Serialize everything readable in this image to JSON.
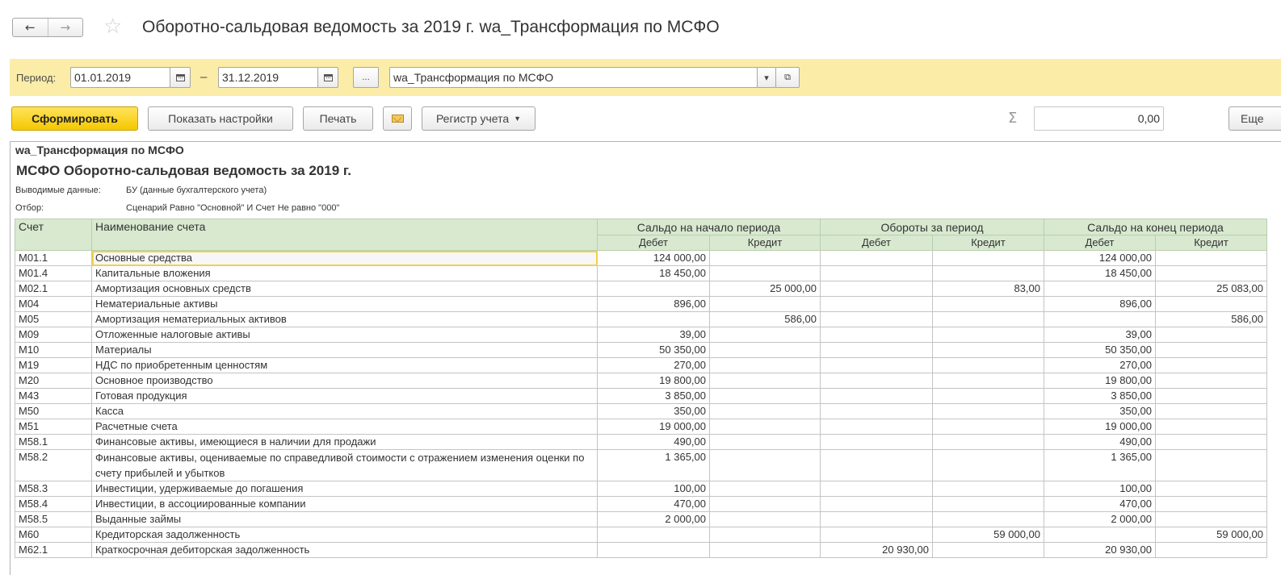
{
  "window": {
    "title": "Оборотно-сальдовая ведомость за 2019 г. wa_Трансформация по МСФО",
    "back_icon": "←",
    "forward_icon": "→",
    "favorite_icon": "☆"
  },
  "period_panel": {
    "label": "Период:",
    "date_from": "01.01.2019",
    "dash": "–",
    "date_to": "31.12.2019",
    "ellipsis": "...",
    "organization": "wa_Трансформация по МСФО",
    "dropdown_icon": "▾",
    "open_icon": "⧉"
  },
  "toolbar": {
    "generate": "Сформировать",
    "show_settings": "Показать настройки",
    "print": "Печать",
    "register": "Регистр учета",
    "sigma": "Σ",
    "sum_value": "0,00",
    "more": "Еще"
  },
  "report": {
    "organization": "wa_Трансформация по МСФО",
    "title": "МСФО Оборотно-сальдовая ведомость за 2019 г.",
    "output_label": "Выводимые данные:",
    "output_value": "БУ (данные бухгалтерского учета)",
    "filter_label": "Отбор:",
    "filter_value": "Сценарий Равно \"Основной\" И Счет Не равно \"000\"",
    "headers": {
      "account": "Счет",
      "name": "Наименование счета",
      "opening": "Сальдо на начало периода",
      "turnover": "Обороты за период",
      "closing": "Сальдо на конец периода",
      "debit": "Дебет",
      "credit": "Кредит"
    },
    "rows": [
      {
        "acc": "М01.1",
        "name": "Основные средства",
        "od": "124 000,00",
        "oc": "",
        "td": "",
        "tc": "",
        "cd": "124 000,00",
        "cc": ""
      },
      {
        "acc": "М01.4",
        "name": "Капитальные вложения",
        "od": "18 450,00",
        "oc": "",
        "td": "",
        "tc": "",
        "cd": "18 450,00",
        "cc": ""
      },
      {
        "acc": "М02.1",
        "name": "Амортизация основных средств",
        "od": "",
        "oc": "25 000,00",
        "td": "",
        "tc": "83,00",
        "cd": "",
        "cc": "25 083,00"
      },
      {
        "acc": "М04",
        "name": "Нематериальные активы",
        "od": "896,00",
        "oc": "",
        "td": "",
        "tc": "",
        "cd": "896,00",
        "cc": ""
      },
      {
        "acc": "М05",
        "name": "Амортизация нематериальных активов",
        "od": "",
        "oc": "586,00",
        "td": "",
        "tc": "",
        "cd": "",
        "cc": "586,00"
      },
      {
        "acc": "М09",
        "name": "Отложенные налоговые активы",
        "od": "39,00",
        "oc": "",
        "td": "",
        "tc": "",
        "cd": "39,00",
        "cc": ""
      },
      {
        "acc": "М10",
        "name": "Материалы",
        "od": "50 350,00",
        "oc": "",
        "td": "",
        "tc": "",
        "cd": "50 350,00",
        "cc": ""
      },
      {
        "acc": "М19",
        "name": "НДС по приобретенным ценностям",
        "od": "270,00",
        "oc": "",
        "td": "",
        "tc": "",
        "cd": "270,00",
        "cc": ""
      },
      {
        "acc": "М20",
        "name": "Основное производство",
        "od": "19 800,00",
        "oc": "",
        "td": "",
        "tc": "",
        "cd": "19 800,00",
        "cc": ""
      },
      {
        "acc": "М43",
        "name": "Готовая продукция",
        "od": "3 850,00",
        "oc": "",
        "td": "",
        "tc": "",
        "cd": "3 850,00",
        "cc": ""
      },
      {
        "acc": "М50",
        "name": "Касса",
        "od": "350,00",
        "oc": "",
        "td": "",
        "tc": "",
        "cd": "350,00",
        "cc": ""
      },
      {
        "acc": "М51",
        "name": "Расчетные счета",
        "od": "19 000,00",
        "oc": "",
        "td": "",
        "tc": "",
        "cd": "19 000,00",
        "cc": ""
      },
      {
        "acc": "М58.1",
        "name": "Финансовые активы, имеющиеся в наличии для продажи",
        "od": "490,00",
        "oc": "",
        "td": "",
        "tc": "",
        "cd": "490,00",
        "cc": ""
      },
      {
        "acc": "М58.2",
        "name": "Финансовые активы, оцениваемые по справедливой стоимости с отражением изменения оценки по счету прибылей и убытков",
        "od": "1 365,00",
        "oc": "",
        "td": "",
        "tc": "",
        "cd": "1 365,00",
        "cc": ""
      },
      {
        "acc": "М58.3",
        "name": "Инвестиции, удерживаемые до погашения",
        "od": "100,00",
        "oc": "",
        "td": "",
        "tc": "",
        "cd": "100,00",
        "cc": ""
      },
      {
        "acc": "М58.4",
        "name": "Инвестиции, в ассоциированные компании",
        "od": "470,00",
        "oc": "",
        "td": "",
        "tc": "",
        "cd": "470,00",
        "cc": ""
      },
      {
        "acc": "М58.5",
        "name": "Выданные займы",
        "od": "2 000,00",
        "oc": "",
        "td": "",
        "tc": "",
        "cd": "2 000,00",
        "cc": ""
      },
      {
        "acc": "М60",
        "name": "Кредиторская задолженность",
        "od": "",
        "oc": "",
        "td": "",
        "tc": "59 000,00",
        "cd": "",
        "cc": "59 000,00"
      },
      {
        "acc": "М62.1",
        "name": "Краткосрочная дебиторская задолженность",
        "od": "",
        "oc": "",
        "td": "20 930,00",
        "tc": "",
        "cd": "20 930,00",
        "cc": ""
      }
    ]
  }
}
